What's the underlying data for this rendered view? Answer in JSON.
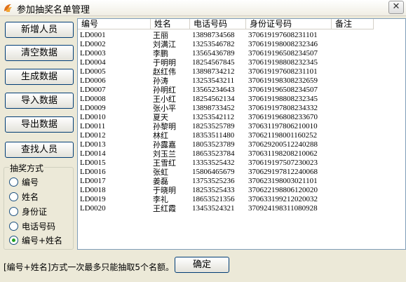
{
  "window": {
    "title": "参加抽奖名单管理",
    "close_glyph": "✕"
  },
  "buttons": {
    "add": "新增人员",
    "clear": "清空数据",
    "generate": "生成数据",
    "import": "导入数据",
    "export": "导出数据",
    "find": "查找人员"
  },
  "lottery_mode": {
    "title": "抽奖方式",
    "options": [
      "编号",
      "姓名",
      "身份证",
      "电话号码",
      "编号+姓名"
    ],
    "selected_index": 4
  },
  "table": {
    "columns": [
      "编号",
      "姓名",
      "电话号码",
      "身份证号码",
      "备注"
    ],
    "rows": [
      {
        "id": "LD0001",
        "name": "王丽",
        "phone": "13898734568",
        "idcard": "370619197608231101",
        "note": ""
      },
      {
        "id": "LD0002",
        "name": "刘满江",
        "phone": "13253546782",
        "idcard": "370619198008232346",
        "note": ""
      },
      {
        "id": "LD0003",
        "name": "李鹏",
        "phone": "13565436789",
        "idcard": "370619196508234507",
        "note": ""
      },
      {
        "id": "LD0004",
        "name": "于明明",
        "phone": "18254567845",
        "idcard": "370619198808232345",
        "note": ""
      },
      {
        "id": "LD0005",
        "name": "赵红伟",
        "phone": "13898734212",
        "idcard": "370619197608231101",
        "note": ""
      },
      {
        "id": "LD0006",
        "name": "孙涛",
        "phone": "13253543211",
        "idcard": "370619198308232659",
        "note": ""
      },
      {
        "id": "LD0007",
        "name": "孙明红",
        "phone": "13565234643",
        "idcard": "370619196508234507",
        "note": ""
      },
      {
        "id": "LD0008",
        "name": "王小红",
        "phone": "18254562134",
        "idcard": "370619198808232345",
        "note": ""
      },
      {
        "id": "LD0009",
        "name": "张小平",
        "phone": "13898733452",
        "idcard": "370619197808234332",
        "note": ""
      },
      {
        "id": "LD0010",
        "name": "夏天",
        "phone": "13253542112",
        "idcard": "370619196808233670",
        "note": ""
      },
      {
        "id": "LD0011",
        "name": "孙黎明",
        "phone": "18253525789",
        "idcard": "370631197806210010",
        "note": ""
      },
      {
        "id": "LD0012",
        "name": "林红",
        "phone": "18353511480",
        "idcard": "370621198001160252",
        "note": ""
      },
      {
        "id": "LD0013",
        "name": "孙露嘉",
        "phone": "18053523789",
        "idcard": "370629200512240288",
        "note": ""
      },
      {
        "id": "LD0014",
        "name": "刘玉兰",
        "phone": "18653523784",
        "idcard": "370631198208210062",
        "note": ""
      },
      {
        "id": "LD0015",
        "name": "王雪红",
        "phone": "13353525432",
        "idcard": "370619197507230023",
        "note": ""
      },
      {
        "id": "LD0016",
        "name": "张虹",
        "phone": "15806465679",
        "idcard": "370629197812240068",
        "note": ""
      },
      {
        "id": "LD0017",
        "name": "姜磊",
        "phone": "13753525236",
        "idcard": "370623198003021101",
        "note": ""
      },
      {
        "id": "LD0018",
        "name": "于晓明",
        "phone": "18253525433",
        "idcard": "370622198806120020",
        "note": ""
      },
      {
        "id": "LD0019",
        "name": "李礼",
        "phone": "18653521356",
        "idcard": "370633199212020032",
        "note": ""
      },
      {
        "id": "LD0020",
        "name": "王红霞",
        "phone": "13453524321",
        "idcard": "370924198311080928",
        "note": ""
      }
    ]
  },
  "status": {
    "message": "[编号+姓名]方式一次最多只能抽取5个名额。"
  },
  "confirm_button": "确定",
  "colors": {
    "accent_border": "#003c74",
    "selected_radio": "#21a121",
    "grid_border": "#7f9db9"
  }
}
